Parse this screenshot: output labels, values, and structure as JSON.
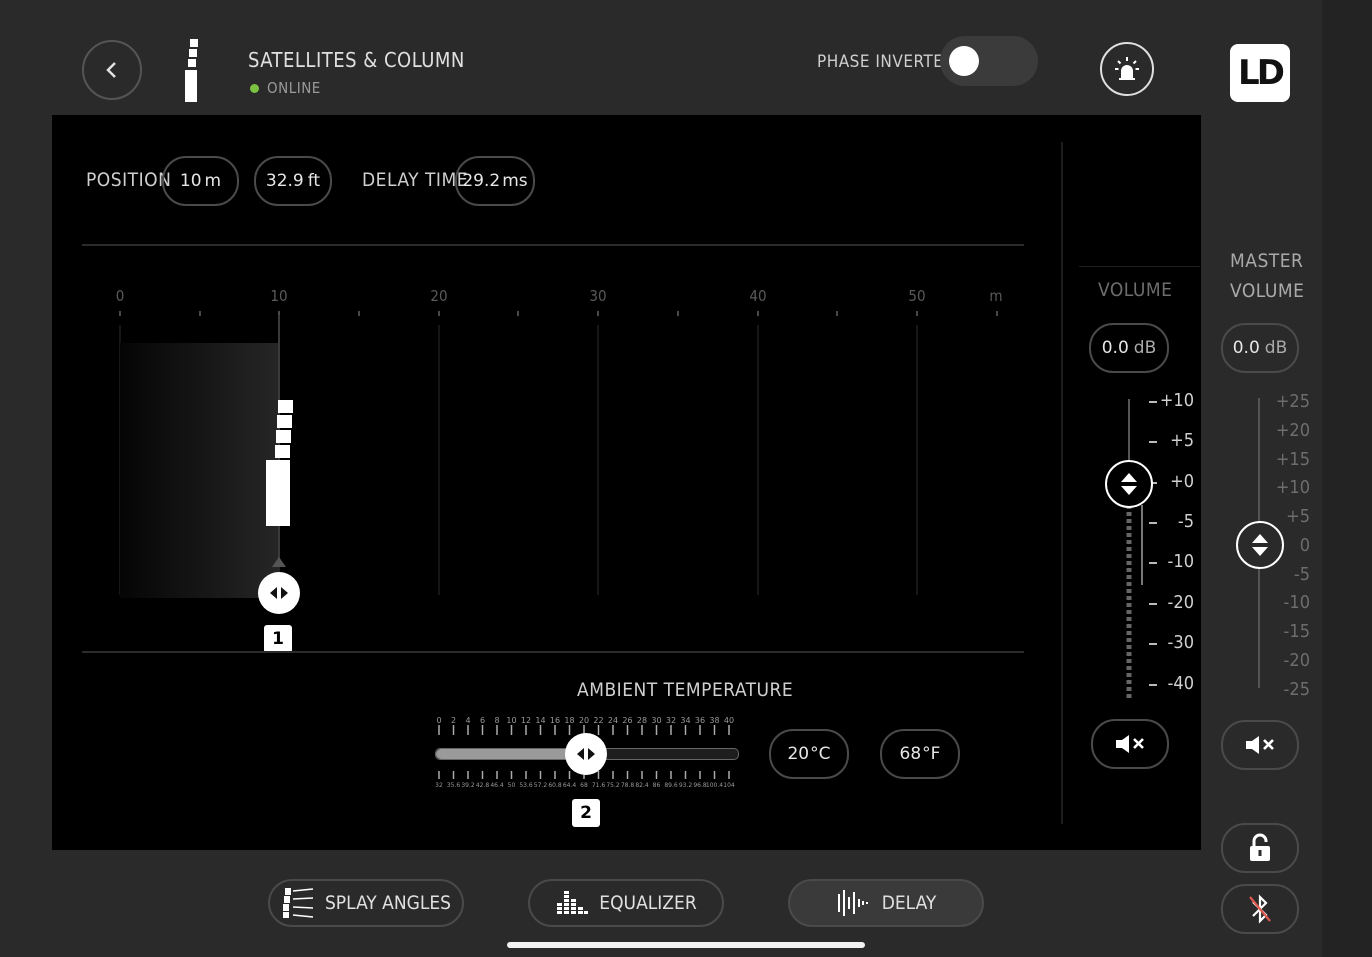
{
  "header": {
    "device_name": "SATELLITES & COLUMN",
    "status": "ONLINE",
    "status_color": "#7cc242",
    "phase_label": "PHASE INVERTED",
    "phase_inverted": false,
    "logo_text": "LD"
  },
  "delay_panel": {
    "position_label": "POSITION",
    "position_m": "10",
    "position_m_unit": "m",
    "position_ft": "32.9",
    "position_ft_unit": "ft",
    "delay_label": "DELAY TIME",
    "delay_value": "29.2",
    "delay_unit": "ms",
    "distance_ticks": [
      "0",
      "10",
      "20",
      "30",
      "40",
      "50",
      "m"
    ],
    "marker_1": "1",
    "ambient_label": "AMBIENT TEMPERATURE",
    "celsius_value": "20",
    "celsius_unit": "°C",
    "fahrenheit_value": "68",
    "fahrenheit_unit": "°F",
    "marker_2": "2"
  },
  "volume": {
    "label": "VOLUME",
    "value": "0.0",
    "unit": "dB",
    "scale": [
      "+10",
      "+5",
      "+0",
      "-5",
      "-10",
      "-20",
      "-30",
      "-40"
    ]
  },
  "master_volume": {
    "label_line1": "MASTER",
    "label_line2": "VOLUME",
    "value": "0.0",
    "unit": "dB",
    "scale": [
      "+25",
      "+20",
      "+15",
      "+10",
      "+5",
      "0",
      "-5",
      "-10",
      "-15",
      "-20",
      "-25"
    ]
  },
  "tabs": {
    "splay": "SPLAY ANGLES",
    "eq": "EQUALIZER",
    "delay": "DELAY"
  },
  "colors": {
    "accent": "#ffffff",
    "panel": "#000000",
    "background": "#2a2a2a",
    "bluetooth_off": "#e05a4f"
  }
}
